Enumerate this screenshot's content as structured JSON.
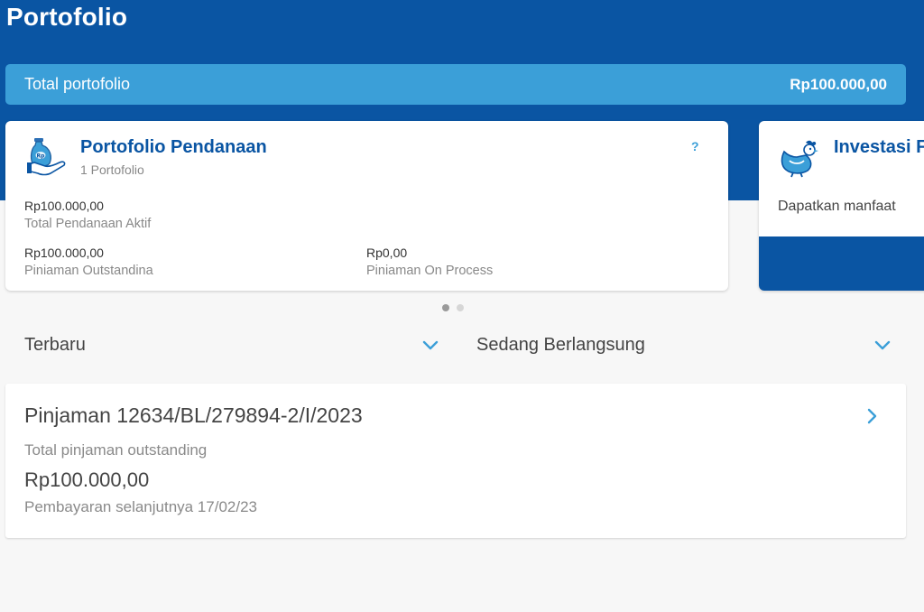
{
  "header": {
    "title": "Portofolio"
  },
  "total": {
    "label": "Total portofolio",
    "value": "Rp100.000,00"
  },
  "cards": {
    "pendanaan": {
      "icon": "money-bag-hand-icon",
      "title": "Portofolio Pendanaan",
      "subtitle": "1 Portofolio",
      "help": "?",
      "active_value": "Rp100.000,00",
      "active_label": "Total Pendanaan Aktif",
      "outstanding_value": "Rp100.000,00",
      "outstanding_label": "Piniaman Outstandina",
      "process_value": "Rp0,00",
      "process_label": "Piniaman On Process"
    },
    "investasi": {
      "icon": "chicken-icon",
      "title": "Investasi F",
      "desc": "Dapatkan manfaat"
    }
  },
  "pager": {
    "count": 2,
    "active": 0
  },
  "filters": {
    "left": {
      "label": "Terbaru"
    },
    "right": {
      "label": "Sedang Berlangsung"
    }
  },
  "loan": {
    "title": "Pinjaman 12634/BL/279894-2/I/2023",
    "sub_label": "Total pinjaman outstanding",
    "amount": "Rp100.000,00",
    "next_payment": "Pembayaran selanjutnya 17/02/23"
  },
  "colors": {
    "primary": "#0a55a3",
    "accent": "#3b9fd8",
    "background": "#f7f7f7"
  }
}
